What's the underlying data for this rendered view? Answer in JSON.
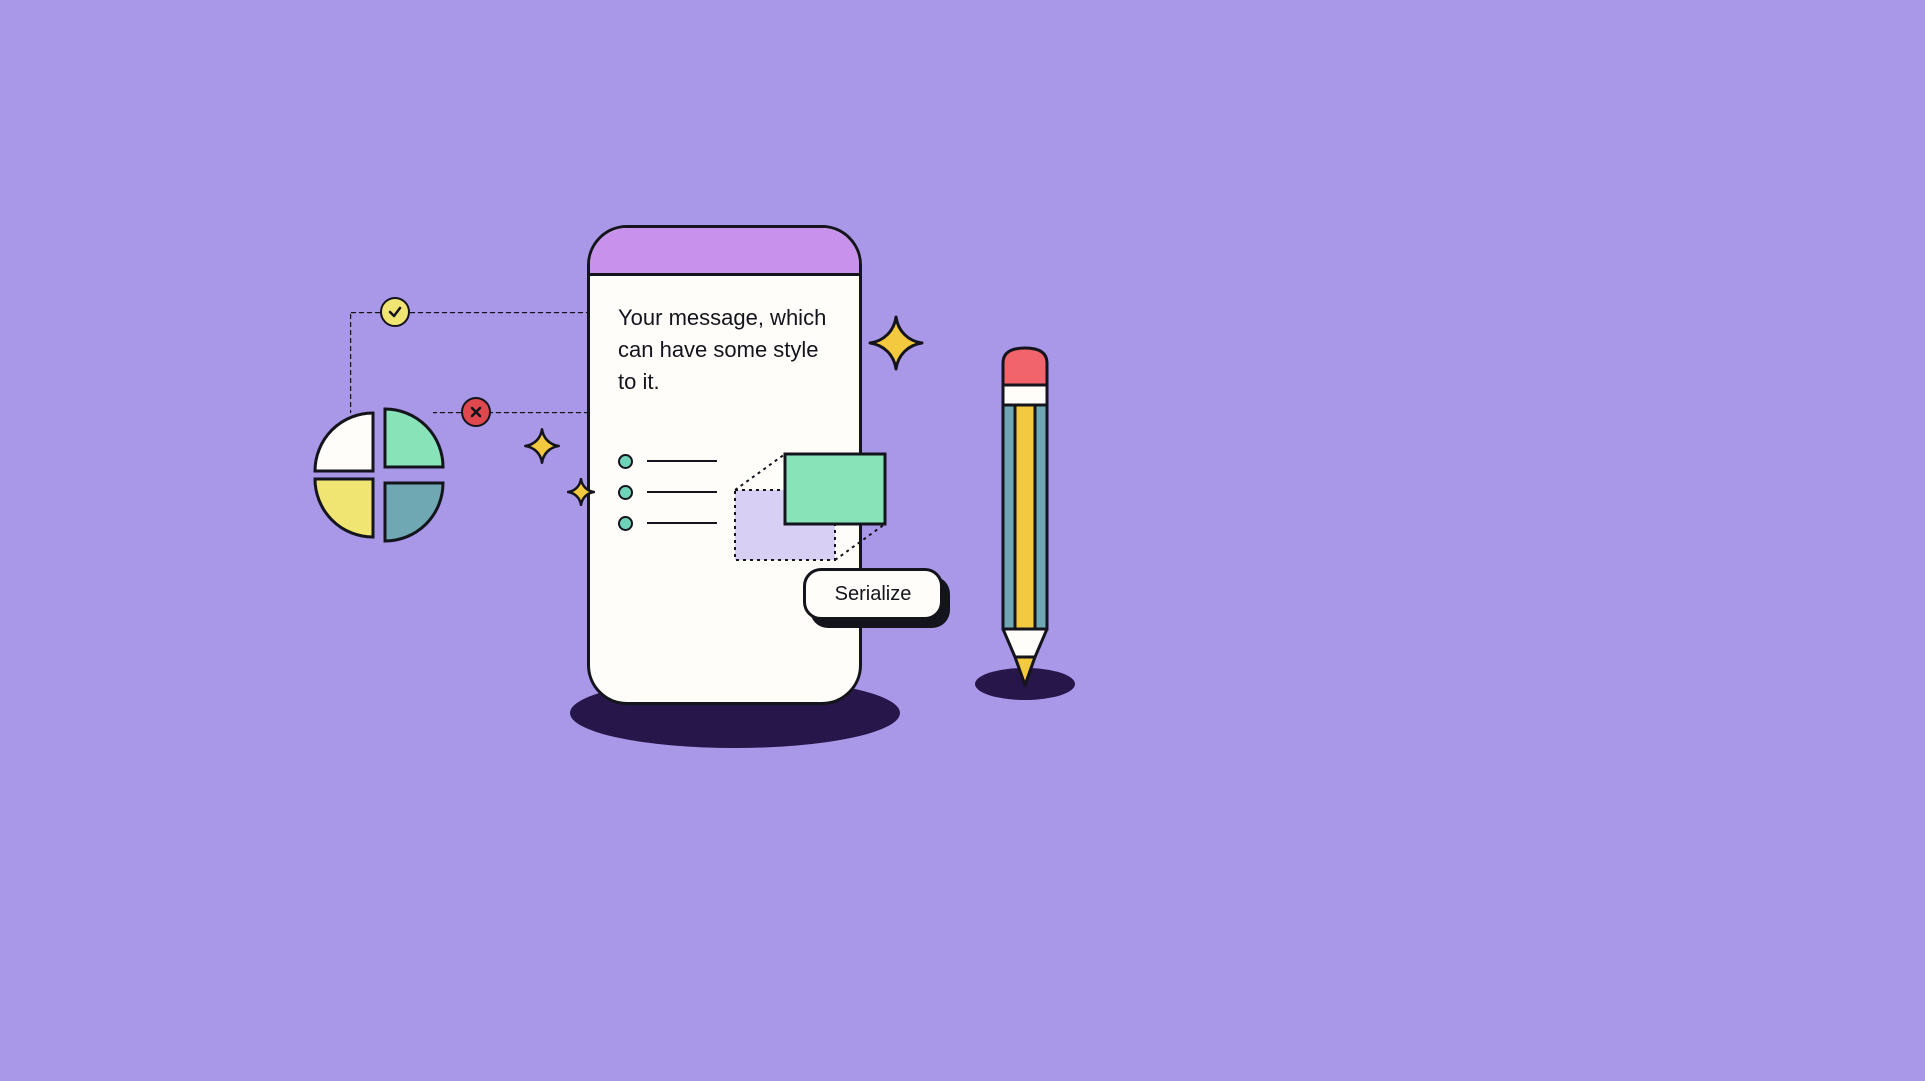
{
  "card": {
    "message": "Your message, which can have some style to it."
  },
  "button": {
    "serialize": "Serialize"
  },
  "colors": {
    "bg": "#a997e8",
    "stroke": "#14141c",
    "card": "#fffdfa",
    "header": "#c892ec",
    "green": "#89e3b8",
    "mint": "#6ed3b7",
    "yellow": "#f0e573",
    "gold": "#f2c93f",
    "red": "#e0484f",
    "teal": "#6fa8b3",
    "lilac": "#d8cff5",
    "shadow": "#27164a",
    "pencilBlue": "#6fa8b3",
    "pencilYellow": "#f2c93f",
    "eraser": "#f2646b"
  }
}
